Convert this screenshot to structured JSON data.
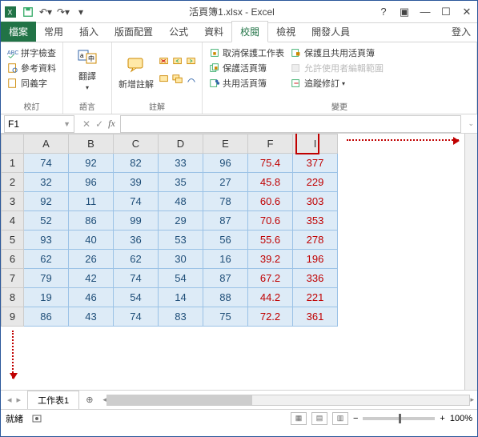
{
  "title": "活頁簿1.xlsx - Excel",
  "tabs": {
    "file": "檔案",
    "home": "常用",
    "insert": "插入",
    "layout": "版面配置",
    "formula": "公式",
    "data": "資料",
    "review": "校閱",
    "view": "檢視",
    "dev": "開發人員"
  },
  "login": "登入",
  "ribbon": {
    "proof": {
      "spell": "拼字檢查",
      "ref": "參考資料",
      "thes": "同義字",
      "label": "校訂"
    },
    "lang": {
      "trans": "翻譯",
      "label": "語言"
    },
    "comment": {
      "new": "新增註解",
      "label": "註解"
    },
    "changes": {
      "unprotect": "取消保護工作表",
      "protect": "保護活頁簿",
      "share": "共用活頁簿",
      "protshare": "保護且共用活頁簿",
      "allow": "允許使用者編輯範圍",
      "track": "追蹤修訂",
      "label": "變更"
    }
  },
  "namebox": "F1",
  "columns": [
    "A",
    "B",
    "C",
    "D",
    "E",
    "F",
    "I"
  ],
  "rows": [
    {
      "n": "1",
      "v": [
        "74",
        "92",
        "82",
        "33",
        "96",
        "75.4",
        "377"
      ]
    },
    {
      "n": "2",
      "v": [
        "32",
        "96",
        "39",
        "35",
        "27",
        "45.8",
        "229"
      ]
    },
    {
      "n": "3",
      "v": [
        "92",
        "11",
        "74",
        "48",
        "78",
        "60.6",
        "303"
      ]
    },
    {
      "n": "4",
      "v": [
        "52",
        "86",
        "99",
        "29",
        "87",
        "70.6",
        "353"
      ]
    },
    {
      "n": "5",
      "v": [
        "93",
        "40",
        "36",
        "53",
        "56",
        "55.6",
        "278"
      ]
    },
    {
      "n": "6",
      "v": [
        "62",
        "26",
        "62",
        "30",
        "16",
        "39.2",
        "196"
      ]
    },
    {
      "n": "7",
      "v": [
        "79",
        "42",
        "74",
        "54",
        "87",
        "67.2",
        "336"
      ]
    },
    {
      "n": "8",
      "v": [
        "19",
        "46",
        "54",
        "14",
        "88",
        "44.2",
        "221"
      ]
    },
    {
      "n": "9",
      "v": [
        "86",
        "43",
        "74",
        "83",
        "75",
        "72.2",
        "361"
      ]
    }
  ],
  "sheet": "工作表1",
  "status": {
    "ready": "就緒",
    "zoom": "100%"
  }
}
